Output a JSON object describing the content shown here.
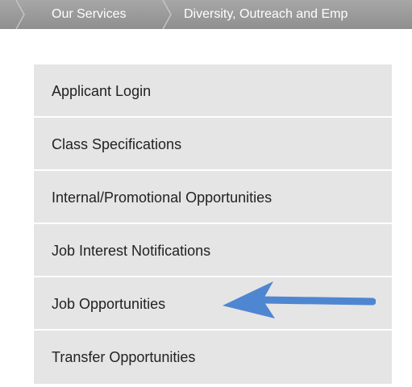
{
  "breadcrumb": {
    "items": [
      {
        "label": "Our Services"
      },
      {
        "label": "Diversity, Outreach and Emp"
      }
    ]
  },
  "menu": {
    "items": [
      {
        "label": "Applicant Login"
      },
      {
        "label": "Class Specifications"
      },
      {
        "label": "Internal/Promotional Opportunities"
      },
      {
        "label": "Job Interest Notifications"
      },
      {
        "label": "Job Opportunities",
        "highlighted": true
      },
      {
        "label": "Transfer Opportunities"
      }
    ]
  },
  "annotation": {
    "arrow_icon": "arrow-left-icon",
    "arrow_color": "#4f86d1",
    "points_to": "Job Opportunities"
  },
  "colors": {
    "breadcrumb_bg": "#9b9b9b",
    "menu_bg": "#e5e5e5",
    "divider": "#ffffff",
    "text": "#222222",
    "crumb_text": "#ffffff"
  }
}
